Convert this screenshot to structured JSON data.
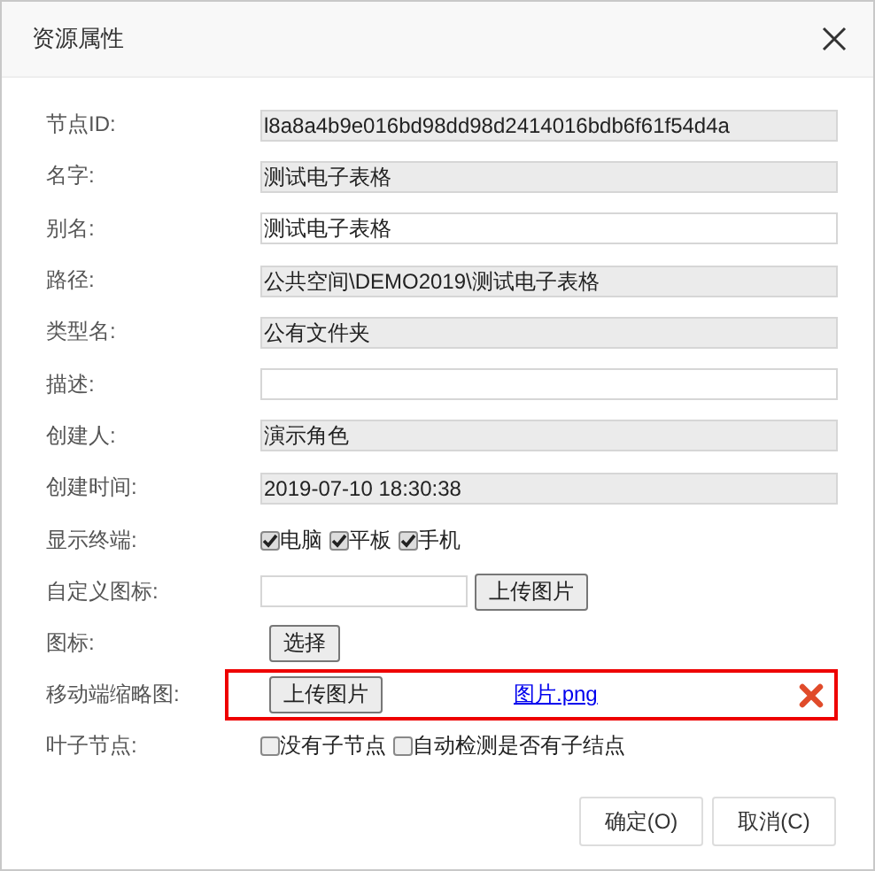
{
  "window": {
    "title": "资源属性"
  },
  "rows": [
    {
      "kind": "readonly",
      "label": "节点ID:",
      "value": "l8a8a4b9e016bd98dd98d2414016bdb6f61f54d4a"
    },
    {
      "kind": "readonly",
      "label": "名字:",
      "value": "测试电子表格"
    },
    {
      "kind": "text",
      "label": "别名:",
      "value": "测试电子表格"
    },
    {
      "kind": "readonly",
      "label": "路径:",
      "value": "公共空间\\DEMO2019\\测试电子表格"
    },
    {
      "kind": "readonly",
      "label": "类型名:",
      "value": "公有文件夹"
    },
    {
      "kind": "text",
      "label": "描述:"
    },
    {
      "kind": "readonly",
      "label": "创建人:",
      "value": "演示角色"
    },
    {
      "kind": "readonly",
      "label": "创建时间:",
      "value": "2019-07-10 18:30:38"
    },
    {
      "kind": "checks",
      "label": "显示终端:",
      "options": [
        {
          "label": "电脑",
          "checked": true
        },
        {
          "label": "平板",
          "checked": true
        },
        {
          "label": "手机",
          "checked": true
        }
      ]
    },
    {
      "kind": "upload",
      "label": "自定义图标:",
      "button": "上传图片"
    },
    {
      "kind": "select",
      "label": "图标:",
      "button": "选择"
    },
    {
      "kind": "thumbnail",
      "label": "移动端缩略图:",
      "button": "上传图片",
      "file": "图片.png",
      "highlighted": true
    },
    {
      "kind": "checks",
      "label": "叶子节点:",
      "options": [
        {
          "label": "没有子节点",
          "checked": false
        },
        {
          "label": "自动检测是否有子结点",
          "checked": false
        }
      ]
    }
  ],
  "buttons": [
    "确定(O)",
    "取消(C)"
  ]
}
